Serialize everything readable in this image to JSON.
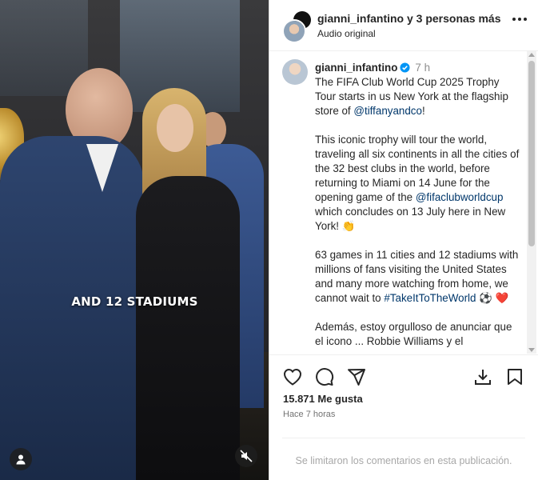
{
  "video": {
    "overlay_caption": "AND 12 STADIUMS"
  },
  "header": {
    "name_line": "gianni_infantino y 3 personas más",
    "sub_line": "Audio original"
  },
  "caption": {
    "username": "gianni_infantino",
    "time_ago": "7 h",
    "para1_a": "The FIFA Club World Cup 2025 Trophy Tour starts in us New York at the flagship store of ",
    "para1_link": "@tiffanyandco",
    "para1_b": "!",
    "para2_a": "This iconic trophy will tour the world, traveling all six continents in all the cities of the 32 best clubs in the world, before returning to Miami on 14 June for the opening game of the ",
    "para2_link": "@fifaclubworldcup",
    "para2_b": " which concludes on 13 July here in New York! 👏",
    "para3_a": "63 games in 11 cities and 12 stadiums with millions of fans visiting the United States and many more watching from home, we cannot wait to ",
    "para3_link": "#TakeItToTheWorld",
    "para3_b": " ⚽ ❤️",
    "para4": "Además, estoy orgulloso de anunciar que el icono ... Robbie Williams y el"
  },
  "stats": {
    "likes": "15.871 Me gusta",
    "posted": "Hace 7 horas"
  },
  "footer": {
    "comments_disabled": "Se limitaron los comentarios en esta publicación."
  },
  "colors": {
    "verified": "#0095f6",
    "link": "#00376b",
    "muted": "#737373"
  }
}
